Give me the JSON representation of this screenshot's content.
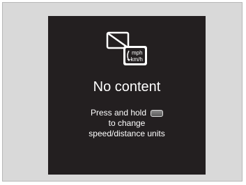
{
  "screen": {
    "title": "No content",
    "icon_name": "no-content-speed-units-icon",
    "icon_units": {
      "top": "mph",
      "bottom": "km/h"
    },
    "instruction_prefix": "Press and hold",
    "instruction_button_icon": "steering-wheel-button-icon",
    "instruction_line2": "to change",
    "instruction_line3": "speed/distance units"
  },
  "colors": {
    "screen_background": "#231f20",
    "frame_background": "#d9d9d9",
    "text": "#ffffff"
  }
}
